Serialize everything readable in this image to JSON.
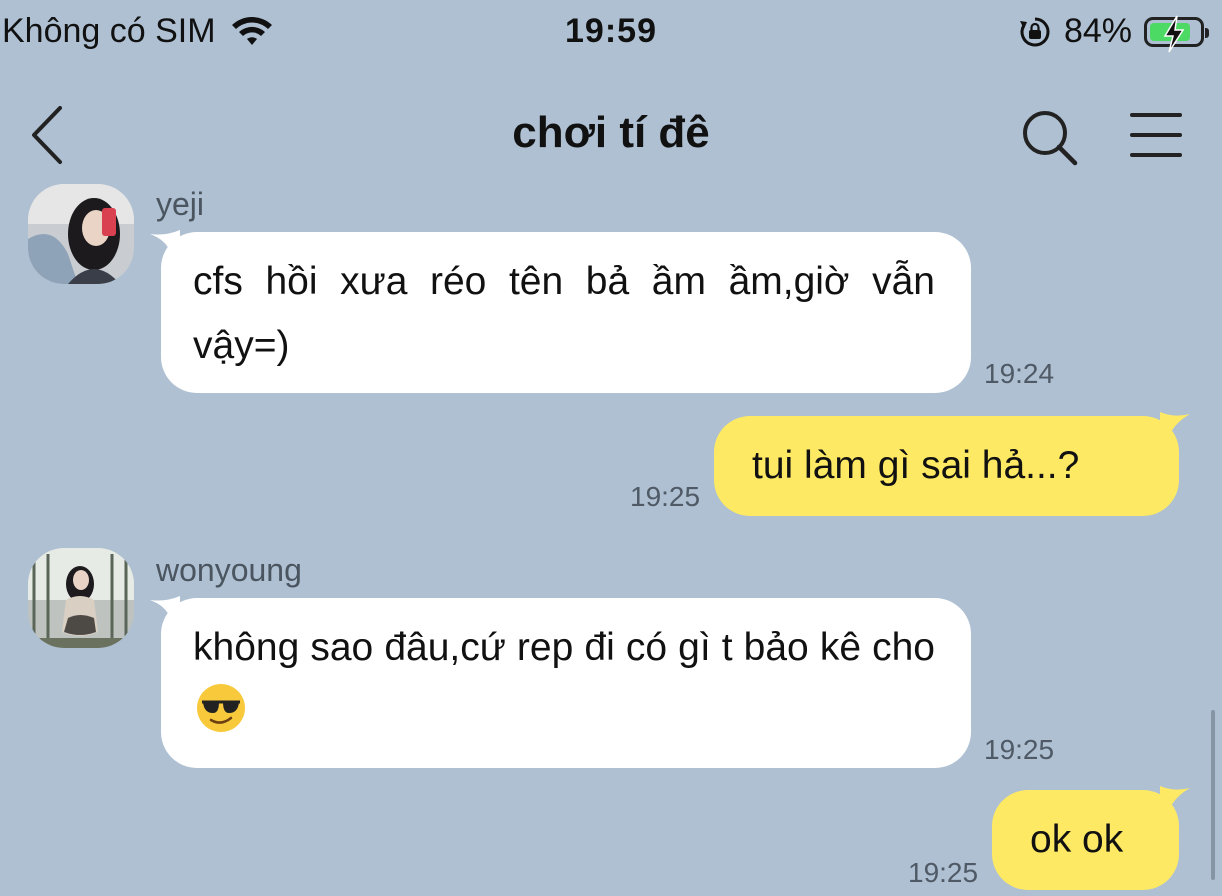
{
  "status_bar": {
    "carrier": "Không có SIM",
    "time": "19:59",
    "battery": "84%",
    "battery_level": 0.84,
    "icons": [
      "wifi-icon",
      "rotation-lock-icon",
      "battery-charging-icon"
    ]
  },
  "header": {
    "title": "chơi tí đê",
    "icons": [
      "back-chevron-icon",
      "search-icon",
      "menu-icon"
    ]
  },
  "messages": [
    {
      "sender": "yeji",
      "text": "cfs hồi xưa réo tên bả ầm ầm,giờ vẫn vậy=)",
      "time": "19:24",
      "direction": "incoming"
    },
    {
      "text": "tui làm gì sai hả...?",
      "time": "19:25",
      "direction": "outgoing"
    },
    {
      "sender": "wonyoung",
      "text": "không sao đâu,cứ rep đi có gì t bảo kê cho",
      "emoji": "smiling-face-with-sunglasses",
      "time": "19:25",
      "direction": "incoming"
    },
    {
      "text": "ok ok",
      "time": "19:25",
      "direction": "outgoing"
    }
  ],
  "colors": {
    "background": "#aec0d2",
    "incoming_bubble": "#ffffff",
    "outgoing_bubble": "#fde963",
    "battery_fill": "#4cd964"
  }
}
